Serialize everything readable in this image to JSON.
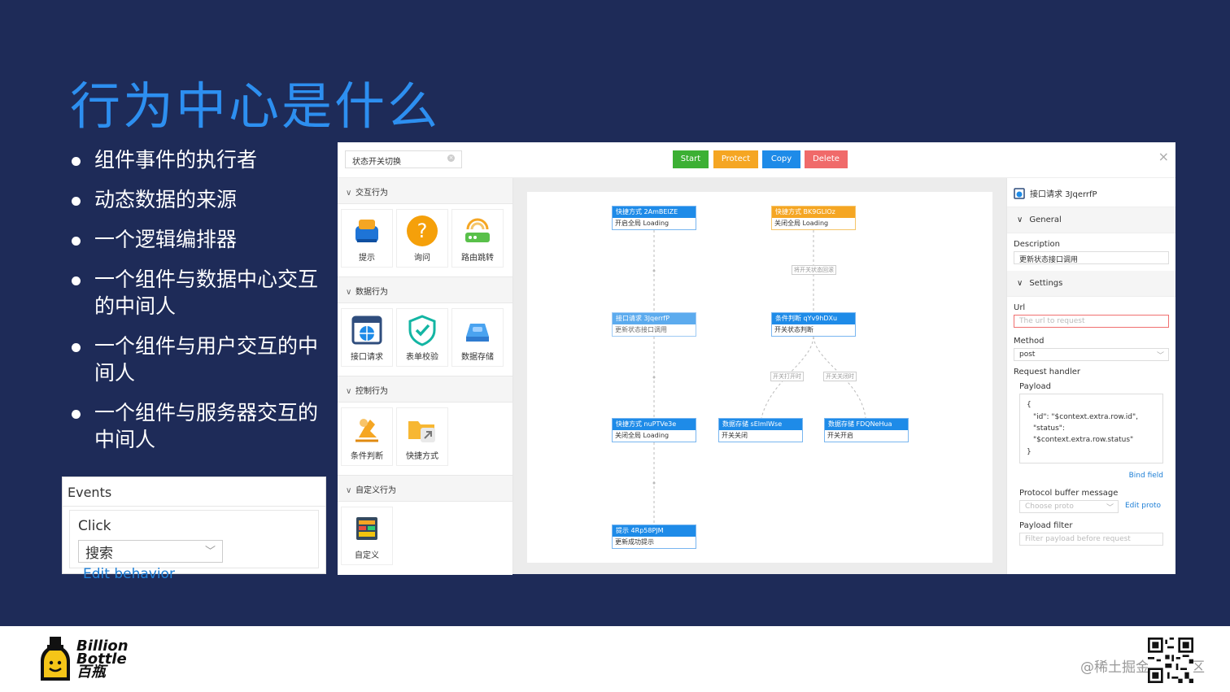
{
  "slide": {
    "title": "行为中心是什么",
    "bullets": [
      "组件事件的执行者",
      "动态数据的来源",
      "一个逻辑编排器",
      "一个组件与数据中心交互的中间人",
      "一个组件与用户交互的中间人",
      "一个组件与服务器交互的中间人"
    ]
  },
  "events_panel": {
    "header": "Events",
    "event_name": "Click",
    "selected_value": "搜索",
    "edit_label": "Edit behavior"
  },
  "app": {
    "search": {
      "value": "状态开关切换"
    },
    "buttons": {
      "start": {
        "label": "Start",
        "color": "#3cb034"
      },
      "protect": {
        "label": "Protect",
        "color": "#f5a623"
      },
      "copy": {
        "label": "Copy",
        "color": "#1e8be8"
      },
      "delete": {
        "label": "Delete",
        "color": "#f06a6a"
      }
    },
    "close_glyph": "×",
    "groups": [
      {
        "label": "交互行为",
        "items": [
          {
            "label": "提示",
            "icon": "toaster-icon"
          },
          {
            "label": "询问",
            "icon": "question-icon"
          },
          {
            "label": "路由跳转",
            "icon": "router-icon"
          }
        ]
      },
      {
        "label": "数据行为",
        "items": [
          {
            "label": "接口请求",
            "icon": "globe-window-icon"
          },
          {
            "label": "表单校验",
            "icon": "shield-check-icon"
          },
          {
            "label": "数据存储",
            "icon": "storage-icon"
          }
        ]
      },
      {
        "label": "控制行为",
        "items": [
          {
            "label": "条件判断",
            "icon": "fork-hand-icon"
          },
          {
            "label": "快捷方式",
            "icon": "folder-shortcut-icon"
          }
        ]
      },
      {
        "label": "自定义行为",
        "items": [
          {
            "label": "自定义",
            "icon": "custom-grid-icon"
          }
        ]
      }
    ],
    "flow": {
      "nodes": [
        {
          "title": "快捷方式 2AmBElZE",
          "sub": "开启全局 Loading"
        },
        {
          "title": "快捷方式 BK9GLIOz",
          "sub": "关闭全局 Loading"
        },
        {
          "title": "接口请求 3JqerrfP",
          "sub": "更新状态接口调用"
        },
        {
          "title": "条件判断 qYv9hDXu",
          "sub": "开关状态判断"
        },
        {
          "title": "快捷方式 nuPTVe3e",
          "sub": "关闭全局 Loading"
        },
        {
          "title": "数据存储 sElmIWse",
          "sub": "开关关闭"
        },
        {
          "title": "数据存储 FDQNeHua",
          "sub": "开关开启"
        },
        {
          "title": "提示 4Rp58PJM",
          "sub": "更新成功提示"
        }
      ],
      "edge_labels": [
        "将开关状态回滚",
        "开关打开时",
        "开关关闭时"
      ]
    },
    "inspector": {
      "header": "接口请求 3JqerrfP",
      "general": "General",
      "description_label": "Description",
      "description_value": "更新状态接口调用",
      "settings": "Settings",
      "url_label": "Url",
      "url_placeholder": "The url to request",
      "method_label": "Method",
      "method_value": "post",
      "request_handler_label": "Request handler",
      "payload_label": "Payload",
      "payload_lines": [
        "{",
        "\"id\": \"$context.extra.row.id\",",
        "\"status\":",
        "\"$context.extra.row.status\"",
        "}"
      ],
      "bind_field": "Bind field",
      "protobuf_label": "Protocol buffer message",
      "protobuf_placeholder": "Choose proto",
      "edit_proto": "Edit proto",
      "payload_filter_label": "Payload filter",
      "payload_filter_placeholder": "Filter payload before request"
    }
  },
  "footer": {
    "brand_lines": [
      "Billion",
      "Bottle",
      "百瓶"
    ],
    "watermark": "@稀土掘金技术社区"
  }
}
